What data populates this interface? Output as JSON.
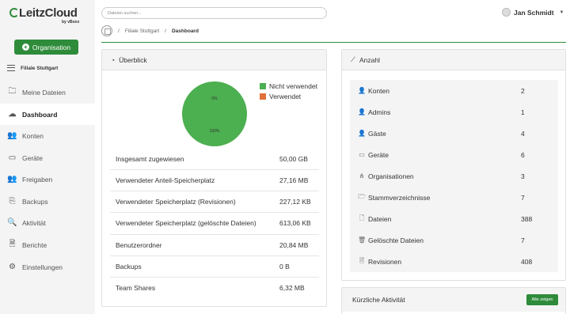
{
  "brand": {
    "name": "LeitzCloud",
    "sub": "by vBoxx"
  },
  "sidebar": {
    "org_button": "Organisation",
    "filiale": "Filiale Stuttgart",
    "items": [
      {
        "label": "Meine Dateien",
        "icon": "folder-icon"
      },
      {
        "label": "Dashboard",
        "icon": "cloud-icon"
      },
      {
        "label": "Konten",
        "icon": "users-icon"
      },
      {
        "label": "Geräte",
        "icon": "monitor-icon"
      },
      {
        "label": "Freigaben",
        "icon": "share-users-icon"
      },
      {
        "label": "Backups",
        "icon": "backup-icon"
      },
      {
        "label": "Aktivität",
        "icon": "activity-icon"
      },
      {
        "label": "Berichte",
        "icon": "report-icon"
      },
      {
        "label": "Einstellungen",
        "icon": "gear-icon"
      }
    ]
  },
  "header": {
    "search_placeholder": "Dateien suchen...",
    "user": "Jan Schmidt"
  },
  "breadcrumb": {
    "sep": "/",
    "items": [
      "Filiale Stuttgart",
      "Dashboard"
    ]
  },
  "overview": {
    "title": "Überblick",
    "pie": {
      "label_top": "0%",
      "label_bottom": "100%"
    },
    "legend": [
      {
        "label": "Nicht verwendet",
        "color": "#4caf50"
      },
      {
        "label": "Verwendet",
        "color": "#e0703a"
      }
    ],
    "rows": [
      {
        "k": "Insgesamt zugewiesen",
        "v": "50,00 GB"
      },
      {
        "k": "Verwendeter Anteil-Speicherplatz",
        "v": "27,16 MB"
      },
      {
        "k": "Verwendeter Speicherplatz (Revisionen)",
        "v": "227,12 KB"
      },
      {
        "k": "Verwendeter Speicherplatz (gelöschte Dateien)",
        "v": "613,06 KB"
      },
      {
        "k": "Benutzerordner",
        "v": "20,84 MB"
      },
      {
        "k": "Backups",
        "v": "0 B"
      },
      {
        "k": "Team Shares",
        "v": "6,32 MB"
      }
    ]
  },
  "counts": {
    "title": "Anzahl",
    "rows": [
      {
        "k": "Konten",
        "v": "2",
        "icon": "user-icon"
      },
      {
        "k": "Admins",
        "v": "1",
        "icon": "admin-icon"
      },
      {
        "k": "Gäste",
        "v": "4",
        "icon": "guest-icon"
      },
      {
        "k": "Geräte",
        "v": "6",
        "icon": "device-icon"
      },
      {
        "k": "Organisationen",
        "v": "3",
        "icon": "org-icon"
      },
      {
        "k": "Stammverzeichnisse",
        "v": "7",
        "icon": "folder-open-icon"
      },
      {
        "k": "Dateien",
        "v": "388",
        "icon": "file-icon"
      },
      {
        "k": "Gelöschte Dateien",
        "v": "7",
        "icon": "trash-icon"
      },
      {
        "k": "Revisionen",
        "v": "408",
        "icon": "revision-icon"
      }
    ]
  },
  "activity": {
    "title": "Kürzliche Aktivität",
    "button": "Alle zeigen"
  }
}
